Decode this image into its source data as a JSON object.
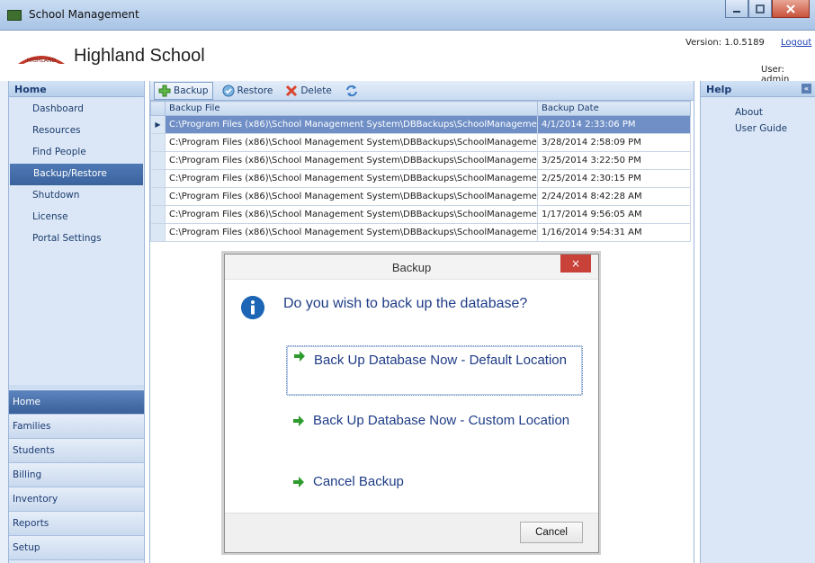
{
  "window": {
    "title": "School Management",
    "buttons": [
      "minimize",
      "maximize",
      "close"
    ]
  },
  "header": {
    "school_name": "Highland School",
    "logo_text": "HIGHLAND",
    "version": "Version: 1.0.5189",
    "logout": "Logout",
    "user": "User: admin"
  },
  "sidebar": {
    "title": "Home",
    "items": [
      {
        "label": "Dashboard"
      },
      {
        "label": "Resources"
      },
      {
        "label": "Find People"
      },
      {
        "label": "Backup/Restore",
        "active": true
      },
      {
        "label": "Shutdown"
      },
      {
        "label": "License"
      },
      {
        "label": "Portal Settings"
      }
    ],
    "sections": [
      {
        "label": "Home",
        "active": true
      },
      {
        "label": "Families"
      },
      {
        "label": "Students"
      },
      {
        "label": "Billing"
      },
      {
        "label": "Inventory"
      },
      {
        "label": "Reports"
      },
      {
        "label": "Setup"
      }
    ]
  },
  "toolbar": {
    "backup": "Backup",
    "restore": "Restore",
    "delete": "Delete"
  },
  "grid": {
    "columns": [
      "Backup File",
      "Backup Date"
    ],
    "rows": [
      {
        "file": "C:\\Program Files (x86)\\School Management System\\DBBackups\\SchoolManageme...",
        "date": "4/1/2014 2:33:06 PM"
      },
      {
        "file": "C:\\Program Files (x86)\\School Management System\\DBBackups\\SchoolManageme...",
        "date": "3/28/2014 2:58:09 PM"
      },
      {
        "file": "C:\\Program Files (x86)\\School Management System\\DBBackups\\SchoolManageme...",
        "date": "3/25/2014 3:22:50 PM"
      },
      {
        "file": "C:\\Program Files (x86)\\School Management System\\DBBackups\\SchoolManageme...",
        "date": "2/25/2014 2:30:15 PM"
      },
      {
        "file": "C:\\Program Files (x86)\\School Management System\\DBBackups\\SchoolManageme...",
        "date": "2/24/2014 8:42:28 AM"
      },
      {
        "file": "C:\\Program Files (x86)\\School Management System\\DBBackups\\SchoolManageme...",
        "date": "1/17/2014 9:56:05 AM"
      },
      {
        "file": "C:\\Program Files (x86)\\School Management System\\DBBackups\\SchoolManageme...",
        "date": "1/16/2014 9:54:31 AM"
      }
    ]
  },
  "help": {
    "title": "Help",
    "items": [
      "About",
      "User Guide"
    ]
  },
  "dialog": {
    "title": "Backup",
    "close_glyph": "×",
    "question": "Do you wish to back up the database?",
    "options": [
      "Back Up Database Now - Default Location",
      "Back Up Database Now - Custom Location",
      "Cancel Backup"
    ],
    "cancel": "Cancel"
  },
  "colors": {
    "accent": "#3b649f",
    "dialog_text": "#1e3c86",
    "info_icon": "#1c66b5",
    "close_red": "#c8423a",
    "arrow_green": "#2e9b2e"
  }
}
